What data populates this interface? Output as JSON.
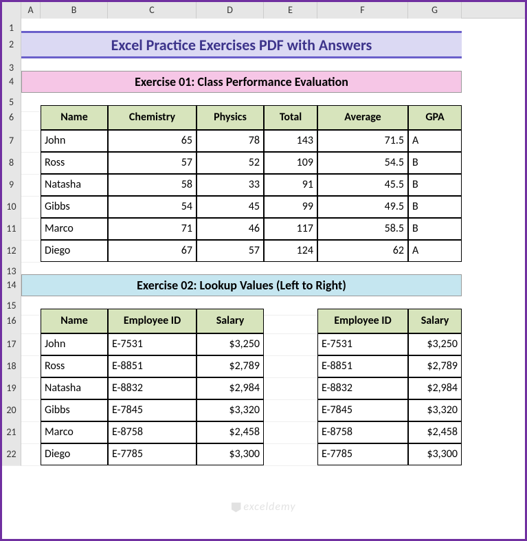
{
  "columns": [
    "",
    "A",
    "B",
    "C",
    "D",
    "E",
    "F",
    "G"
  ],
  "row_numbers": [
    "1",
    "2",
    "3",
    "4",
    "5",
    "6",
    "7",
    "8",
    "9",
    "10",
    "11",
    "12",
    "13",
    "14",
    "15",
    "16",
    "17",
    "18",
    "19",
    "20",
    "21",
    "22"
  ],
  "title": "Excel Practice Exercises PDF with Answers",
  "exercise1": {
    "heading": "Exercise 01: Class Performance Evaluation",
    "headers": [
      "Name",
      "Chemistry",
      "Physics",
      "Total",
      "Average",
      "GPA"
    ],
    "rows": [
      {
        "name": "John",
        "chem": "65",
        "phys": "78",
        "total": "143",
        "avg": "71.5",
        "gpa": "A"
      },
      {
        "name": "Ross",
        "chem": "57",
        "phys": "52",
        "total": "109",
        "avg": "54.5",
        "gpa": "B"
      },
      {
        "name": "Natasha",
        "chem": "58",
        "phys": "33",
        "total": "91",
        "avg": "45.5",
        "gpa": "B"
      },
      {
        "name": "Gibbs",
        "chem": "54",
        "phys": "45",
        "total": "99",
        "avg": "49.5",
        "gpa": "B"
      },
      {
        "name": "Marco",
        "chem": "71",
        "phys": "46",
        "total": "117",
        "avg": "58.5",
        "gpa": "B"
      },
      {
        "name": "Diego",
        "chem": "67",
        "phys": "57",
        "total": "124",
        "avg": "62",
        "gpa": "A"
      }
    ]
  },
  "exercise2": {
    "heading": "Exercise 02: Lookup Values (Left to Right)",
    "left_headers": [
      "Name",
      "Employee ID",
      "Salary"
    ],
    "right_headers": [
      "Employee ID",
      "Salary"
    ],
    "rows": [
      {
        "name": "John",
        "id": "E-7531",
        "salary": "$3,250",
        "rid": "E-7531",
        "rsal": "$3,250"
      },
      {
        "name": "Ross",
        "id": "E-8851",
        "salary": "$2,789",
        "rid": "E-8851",
        "rsal": "$2,789"
      },
      {
        "name": "Natasha",
        "id": "E-8832",
        "salary": "$2,984",
        "rid": "E-8832",
        "rsal": "$2,984"
      },
      {
        "name": "Gibbs",
        "id": "E-7845",
        "salary": "$3,320",
        "rid": "E-7845",
        "rsal": "$3,320"
      },
      {
        "name": "Marco",
        "id": "E-8758",
        "salary": "$2,458",
        "rid": "E-8758",
        "rsal": "$2,458"
      },
      {
        "name": "Diego",
        "id": "E-7785",
        "salary": "$3,300",
        "rid": "E-7785",
        "rsal": "$3,300"
      }
    ]
  },
  "watermark": "exceldemy"
}
